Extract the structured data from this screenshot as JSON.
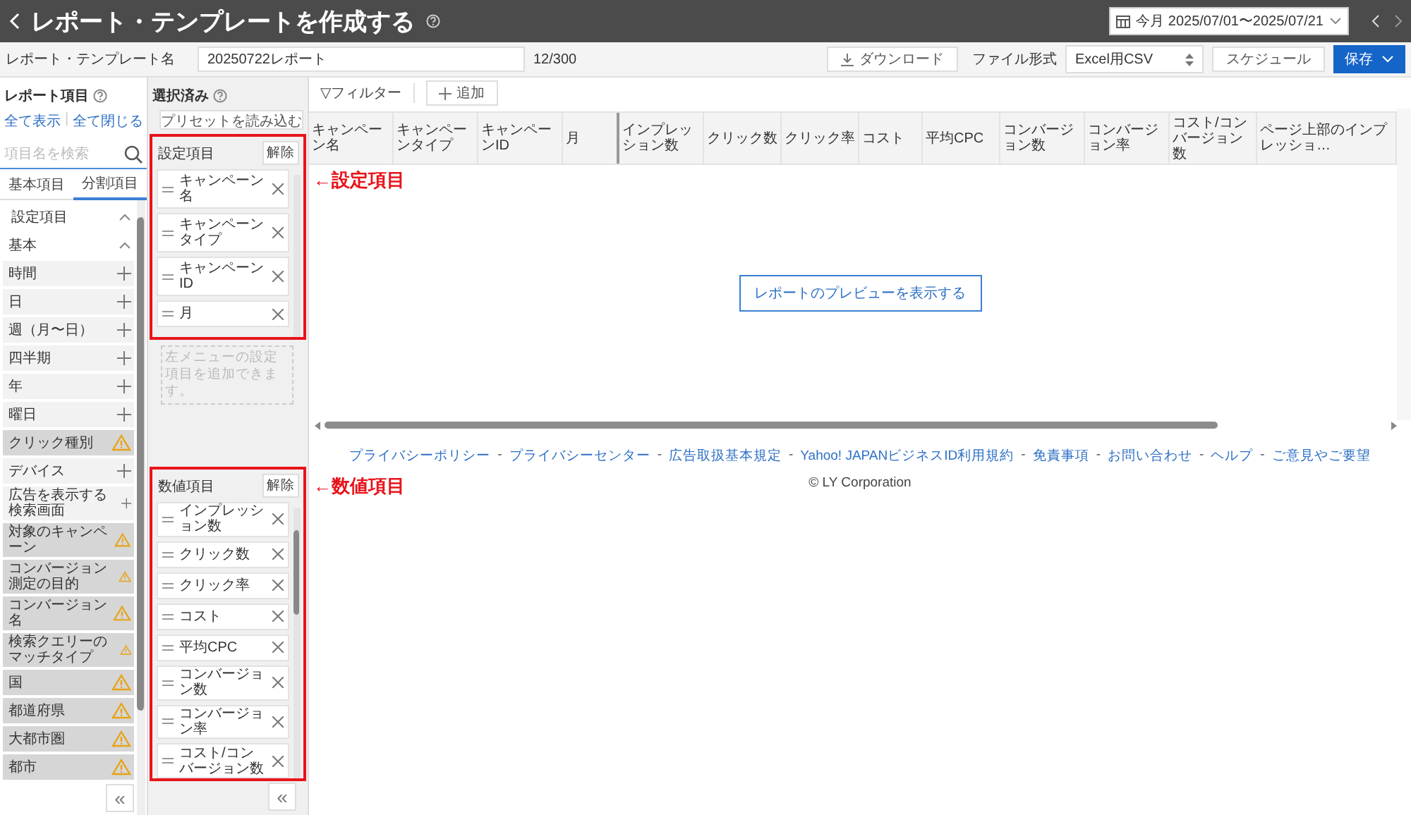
{
  "header": {
    "title": "レポート・テンプレートを作成する",
    "date_range": "今月 2025/07/01〜2025/07/21"
  },
  "toolbar": {
    "name_label": "レポート・テンプレート名",
    "name_value": "20250722レポート",
    "char_count": "12/300",
    "download_button": "ダウンロード",
    "file_format_label": "ファイル形式",
    "file_format_value": "Excel用CSV",
    "schedule_button": "スケジュール",
    "save_button": "保存"
  },
  "report_items": {
    "title": "レポート項目",
    "links": [
      "全て表示",
      "全て閉じる"
    ],
    "links_separator": "|",
    "search_placeholder": "項目名を検索",
    "tabs": [
      {
        "label": "基本項目",
        "selected": false
      },
      {
        "label": "分割項目",
        "selected": true
      }
    ],
    "items": [
      {
        "label": "設定項目",
        "kind": "header",
        "expanded": true
      },
      {
        "label": "基本",
        "kind": "group",
        "expanded": true
      },
      {
        "label": "時間",
        "kind": "addable"
      },
      {
        "label": "日",
        "kind": "addable"
      },
      {
        "label": "週（月〜日）",
        "kind": "addable"
      },
      {
        "label": "四半期",
        "kind": "addable"
      },
      {
        "label": "年",
        "kind": "addable"
      },
      {
        "label": "曜日",
        "kind": "addable"
      },
      {
        "label": "クリック種別",
        "kind": "unavailable"
      },
      {
        "label": "デバイス",
        "kind": "addable"
      },
      {
        "label": "広告を表示する検索画面",
        "kind": "addable"
      },
      {
        "label": "対象のキャンペーン",
        "kind": "unavailable"
      },
      {
        "label": "コンバージョン測定の目的",
        "kind": "unavailable"
      },
      {
        "label": "コンバージョン名",
        "kind": "unavailable"
      },
      {
        "label": "検索クエリーのマッチタイプ",
        "kind": "unavailable"
      },
      {
        "label": "国",
        "kind": "unavailable"
      },
      {
        "label": "都道府県",
        "kind": "unavailable"
      },
      {
        "label": "大都市圏",
        "kind": "unavailable"
      },
      {
        "label": "都市",
        "kind": "unavailable"
      }
    ],
    "collapse_button": "«"
  },
  "selected": {
    "title": "選択済み",
    "preset_button": "プリセットを読み込む",
    "sections": [
      {
        "title": "設定項目",
        "clear_button": "解除",
        "chips": [
          "キャンペーン名",
          "キャンペーンタイプ",
          "キャンペーンID",
          "月"
        ],
        "hint": "左メニューの設定項目を追加できます。"
      },
      {
        "title": "数値項目",
        "clear_button": "解除",
        "chips": [
          "インプレッション数",
          "クリック数",
          "クリック率",
          "コスト",
          "平均CPC",
          "コンバージョン数",
          "コンバージョン率",
          "コスト/コンバージョン数"
        ]
      }
    ],
    "collapse_button": "«"
  },
  "annotations": [
    {
      "text": "←設定項目"
    },
    {
      "text": "←数値項目"
    }
  ],
  "table": {
    "filter_button": "▽フィルター",
    "add_button": "追加",
    "columns": [
      "キャンペーン名",
      "キャンペーンタイプ",
      "キャンペーンID",
      "月",
      "インプレッション数",
      "クリック数",
      "クリック率",
      "コスト",
      "平均CPC",
      "コンバージョン数",
      "コンバージョン率",
      "コスト/コンバージョン数",
      "ページ上部のインプレッショ…"
    ],
    "preview_button": "レポートのプレビューを表示する"
  },
  "footer": {
    "links": [
      "プライバシーポリシー",
      "プライバシーセンター",
      "広告取扱基本規定",
      "Yahoo! JAPANビジネスID利用規約",
      "免責事項",
      "お問い合わせ",
      "ヘルプ",
      "ご意見やご要望"
    ],
    "separator": "-",
    "copyright": "© LY Corporation"
  }
}
